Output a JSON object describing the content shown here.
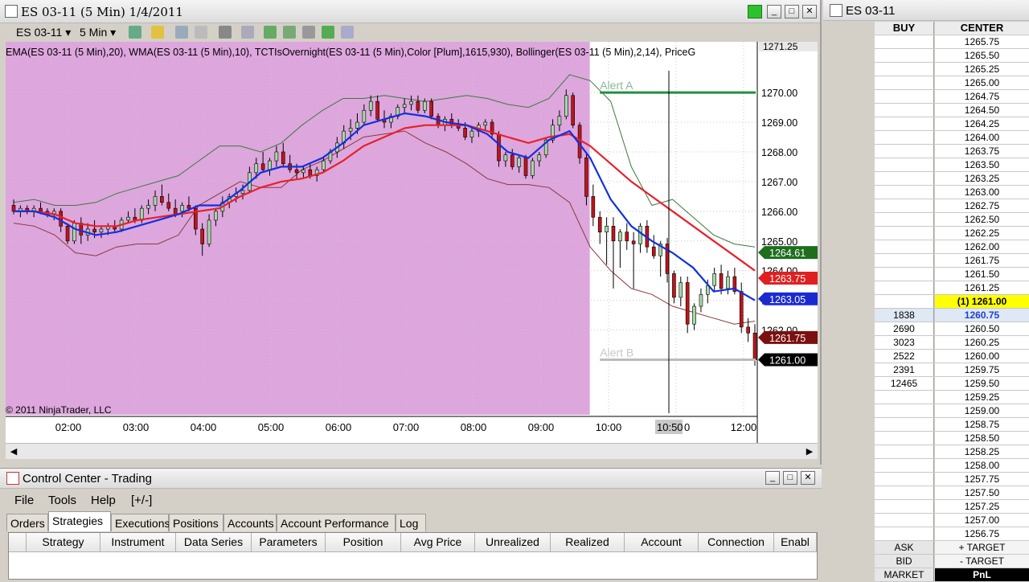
{
  "chart_window": {
    "title": "ES 03-11 (5 Min)  1/4/2011",
    "instrument_selector": "ES 03-11",
    "interval_selector": "5 Min",
    "indicator_label": "EMA(ES 03-11  (5 Min),20),  WMA(ES 03-11  (5 Min),10),  TCTIsOvernight(ES 03-11  (5 Min),Color  [Plum],1615,930),  Bollinger(ES 03-11  (5  Min),2,14),   PriceG",
    "copyright": "© 2011 NinjaTrader, LLC",
    "alert_a": "Alert A",
    "alert_b": "Alert B",
    "crosshair_time_label": "10:50",
    "crosshair_time_suffix": "0",
    "colors": {
      "overnight": "#dda6dd",
      "ema": "#e8202a",
      "wma": "#1030e0",
      "bollinger_overnight": "#5d7a5d",
      "bollinger_day": "#3a7a3a",
      "candle_up": "#a8d8a8",
      "candle_down": "#c0141a",
      "alert_a_line": "#209040",
      "alert_b_line": "#bbbbbb"
    },
    "price_markers": [
      {
        "label": "1264.61",
        "bg": "#1e6e1e",
        "value": 1264.61
      },
      {
        "label": "1263.75",
        "bg": "#e02020",
        "value": 1263.75
      },
      {
        "label": "1263.05",
        "bg": "#1a2ad0",
        "value": 1263.05
      },
      {
        "label": "1261.75",
        "bg": "#7a1010",
        "value": 1261.75
      },
      {
        "label": "1261.00",
        "bg": "#000000",
        "value": 1261.0
      }
    ],
    "top_price_label": "1271.25"
  },
  "chart_data": {
    "type": "candlestick",
    "y_ticks": [
      "1270.00",
      "1269.00",
      "1268.00",
      "1267.00",
      "1266.00",
      "1265.00",
      "1264.00",
      "1263.00",
      "1262.00"
    ],
    "x_ticks": [
      "02:00",
      "03:00",
      "04:00",
      "05:00",
      "06:00",
      "07:00",
      "08:00",
      "09:00",
      "10:00",
      "11:00",
      "12:00"
    ],
    "ylim": [
      1259.2,
      1271.6
    ],
    "alert_a_price": 1270.0,
    "alert_b_price": 1261.0,
    "bars": [
      [
        1266.2,
        1266.4,
        1265.9,
        1266.0
      ],
      [
        1266.0,
        1266.2,
        1265.8,
        1266.1
      ],
      [
        1266.1,
        1266.2,
        1265.9,
        1266.0
      ],
      [
        1266.0,
        1266.2,
        1265.8,
        1266.1
      ],
      [
        1266.1,
        1266.3,
        1265.9,
        1266.0
      ],
      [
        1266.0,
        1266.1,
        1265.8,
        1265.9
      ],
      [
        1265.9,
        1266.1,
        1265.7,
        1266.0
      ],
      [
        1266.0,
        1266.1,
        1265.3,
        1265.5
      ],
      [
        1265.5,
        1265.6,
        1264.9,
        1265.0
      ],
      [
        1265.0,
        1265.7,
        1264.9,
        1265.6
      ],
      [
        1265.6,
        1265.8,
        1264.9,
        1265.2
      ],
      [
        1265.2,
        1265.6,
        1265.0,
        1265.4
      ],
      [
        1265.4,
        1265.7,
        1265.1,
        1265.3
      ],
      [
        1265.3,
        1265.5,
        1265.1,
        1265.4
      ],
      [
        1265.4,
        1265.6,
        1265.2,
        1265.5
      ],
      [
        1265.5,
        1265.7,
        1265.3,
        1265.4
      ],
      [
        1265.4,
        1265.8,
        1265.3,
        1265.7
      ],
      [
        1265.7,
        1266.0,
        1265.6,
        1265.8
      ],
      [
        1265.8,
        1266.1,
        1265.6,
        1265.7
      ],
      [
        1265.7,
        1266.2,
        1265.6,
        1266.1
      ],
      [
        1266.1,
        1266.4,
        1265.9,
        1266.2
      ],
      [
        1266.2,
        1266.7,
        1266.0,
        1266.5
      ],
      [
        1266.5,
        1266.9,
        1266.2,
        1266.3
      ],
      [
        1266.3,
        1266.6,
        1266.0,
        1266.1
      ],
      [
        1266.1,
        1266.4,
        1265.8,
        1265.9
      ],
      [
        1266.0,
        1266.3,
        1265.8,
        1266.2
      ],
      [
        1266.2,
        1266.5,
        1266.0,
        1266.1
      ],
      [
        1266.1,
        1266.2,
        1265.2,
        1265.4
      ],
      [
        1265.4,
        1265.6,
        1264.5,
        1264.9
      ],
      [
        1264.9,
        1265.9,
        1264.8,
        1265.7
      ],
      [
        1265.7,
        1266.1,
        1265.5,
        1266.0
      ],
      [
        1266.0,
        1266.5,
        1265.8,
        1266.3
      ],
      [
        1266.3,
        1266.6,
        1266.1,
        1266.5
      ],
      [
        1266.5,
        1266.8,
        1266.3,
        1266.6
      ],
      [
        1266.6,
        1266.9,
        1266.4,
        1266.7
      ],
      [
        1266.7,
        1267.5,
        1266.6,
        1267.3
      ],
      [
        1267.3,
        1267.8,
        1267.1,
        1267.6
      ],
      [
        1267.6,
        1268.0,
        1267.3,
        1267.4
      ],
      [
        1267.4,
        1267.8,
        1267.2,
        1267.7
      ],
      [
        1267.7,
        1268.2,
        1267.5,
        1268.0
      ],
      [
        1268.0,
        1268.3,
        1267.5,
        1267.6
      ],
      [
        1267.6,
        1267.9,
        1267.3,
        1267.4
      ],
      [
        1267.4,
        1267.6,
        1267.1,
        1267.3
      ],
      [
        1267.3,
        1267.5,
        1267.1,
        1267.4
      ],
      [
        1267.4,
        1267.6,
        1267.1,
        1267.2
      ],
      [
        1267.2,
        1267.5,
        1267.0,
        1267.4
      ],
      [
        1267.4,
        1267.8,
        1267.3,
        1267.7
      ],
      [
        1267.7,
        1268.1,
        1267.6,
        1268.0
      ],
      [
        1268.0,
        1268.5,
        1267.8,
        1268.3
      ],
      [
        1268.3,
        1268.9,
        1268.1,
        1268.7
      ],
      [
        1268.7,
        1269.1,
        1268.4,
        1268.8
      ],
      [
        1268.8,
        1269.3,
        1268.6,
        1269.0
      ],
      [
        1269.0,
        1269.6,
        1268.9,
        1269.4
      ],
      [
        1269.4,
        1269.9,
        1269.2,
        1269.7
      ],
      [
        1269.7,
        1269.9,
        1269.0,
        1269.1
      ],
      [
        1269.1,
        1269.4,
        1268.8,
        1269.0
      ],
      [
        1269.0,
        1269.3,
        1268.8,
        1269.2
      ],
      [
        1269.2,
        1269.6,
        1269.1,
        1269.5
      ],
      [
        1269.5,
        1269.8,
        1269.3,
        1269.6
      ],
      [
        1269.6,
        1269.9,
        1269.4,
        1269.7
      ],
      [
        1269.7,
        1269.9,
        1269.3,
        1269.4
      ],
      [
        1269.4,
        1269.8,
        1269.3,
        1269.7
      ],
      [
        1269.7,
        1269.8,
        1269.1,
        1269.2
      ],
      [
        1269.2,
        1269.3,
        1268.8,
        1268.9
      ],
      [
        1268.9,
        1269.2,
        1268.7,
        1269.1
      ],
      [
        1269.1,
        1269.3,
        1268.8,
        1268.9
      ],
      [
        1268.9,
        1269.1,
        1268.7,
        1268.8
      ],
      [
        1268.8,
        1269.0,
        1268.4,
        1268.5
      ],
      [
        1268.5,
        1268.8,
        1268.3,
        1268.7
      ],
      [
        1268.7,
        1269.0,
        1268.5,
        1268.9
      ],
      [
        1268.9,
        1269.1,
        1268.7,
        1269.0
      ],
      [
        1269.0,
        1269.1,
        1268.5,
        1268.6
      ],
      [
        1268.6,
        1268.7,
        1267.5,
        1267.7
      ],
      [
        1267.7,
        1268.0,
        1267.5,
        1267.9
      ],
      [
        1267.9,
        1268.1,
        1267.4,
        1267.5
      ],
      [
        1267.5,
        1267.9,
        1267.3,
        1267.8
      ],
      [
        1267.8,
        1267.9,
        1267.1,
        1267.2
      ],
      [
        1267.2,
        1267.8,
        1267.1,
        1267.7
      ],
      [
        1267.7,
        1268.0,
        1267.5,
        1267.9
      ],
      [
        1267.9,
        1268.5,
        1267.8,
        1268.4
      ],
      [
        1268.4,
        1269.1,
        1268.3,
        1268.9
      ],
      [
        1268.9,
        1269.4,
        1268.7,
        1269.2
      ],
      [
        1269.2,
        1270.1,
        1269.1,
        1269.9
      ],
      [
        1269.9,
        1270.0,
        1268.8,
        1268.9
      ],
      [
        1268.9,
        1269.0,
        1267.6,
        1267.8
      ],
      [
        1267.8,
        1268.0,
        1266.2,
        1266.5
      ],
      [
        1266.5,
        1266.9,
        1265.5,
        1265.8
      ],
      [
        1265.8,
        1266.0,
        1264.9,
        1265.3
      ],
      [
        1265.3,
        1265.8,
        1264.2,
        1265.5
      ],
      [
        1265.5,
        1265.8,
        1263.4,
        1265.0
      ],
      [
        1265.0,
        1265.4,
        1264.1,
        1265.3
      ],
      [
        1265.3,
        1265.6,
        1264.7,
        1265.0
      ],
      [
        1265.0,
        1265.3,
        1263.4,
        1264.9
      ],
      [
        1264.9,
        1265.6,
        1264.6,
        1265.5
      ],
      [
        1265.5,
        1265.7,
        1264.6,
        1264.8
      ],
      [
        1264.8,
        1265.2,
        1264.4,
        1264.5
      ],
      [
        1264.5,
        1265.0,
        1263.8,
        1264.9
      ],
      [
        1264.9,
        1265.1,
        1263.6,
        1263.9
      ],
      [
        1263.9,
        1264.0,
        1262.9,
        1263.1
      ],
      [
        1263.1,
        1263.8,
        1262.8,
        1263.6
      ],
      [
        1263.6,
        1263.8,
        1261.9,
        1262.2
      ],
      [
        1262.2,
        1262.9,
        1262.0,
        1262.8
      ],
      [
        1262.8,
        1263.4,
        1262.6,
        1263.2
      ],
      [
        1263.2,
        1263.7,
        1262.9,
        1263.5
      ],
      [
        1263.5,
        1264.1,
        1263.3,
        1263.9
      ],
      [
        1263.9,
        1264.2,
        1263.2,
        1263.4
      ],
      [
        1263.4,
        1264.0,
        1263.2,
        1263.8
      ],
      [
        1263.8,
        1264.1,
        1263.2,
        1263.3
      ],
      [
        1263.3,
        1263.6,
        1261.9,
        1262.1
      ],
      [
        1262.1,
        1262.4,
        1261.6,
        1261.9
      ],
      [
        1261.9,
        1262.2,
        1260.8,
        1261.0
      ]
    ],
    "ema_path": [
      1266.0,
      1266.0,
      1265.9,
      1265.6,
      1265.5,
      1265.5,
      1265.7,
      1265.8,
      1265.9,
      1266.0,
      1266.1,
      1266.5,
      1266.8,
      1267.0,
      1267.1,
      1267.3,
      1267.7,
      1268.2,
      1268.5,
      1268.8,
      1268.9,
      1268.9,
      1268.9,
      1268.7,
      1268.5,
      1268.3,
      1268.5,
      1268.6,
      1268.2,
      1267.6,
      1267.0,
      1266.5,
      1266.0,
      1265.5,
      1265.0,
      1264.5,
      1264.0
    ],
    "wma_path": [
      1266.0,
      1266.0,
      1265.8,
      1265.4,
      1265.2,
      1265.3,
      1265.5,
      1265.7,
      1265.9,
      1266.2,
      1266.2,
      1266.7,
      1267.3,
      1267.5,
      1267.5,
      1267.8,
      1268.3,
      1268.9,
      1269.1,
      1269.3,
      1269.2,
      1269.0,
      1268.9,
      1268.6,
      1268.0,
      1267.8,
      1268.4,
      1268.7,
      1267.8,
      1266.4,
      1265.5,
      1265.0,
      1264.6,
      1264.1,
      1263.3,
      1263.4,
      1263.0
    ],
    "bb_upper_path": [
      1266.3,
      1266.4,
      1266.2,
      1266.2,
      1266.3,
      1266.6,
      1266.8,
      1267.0,
      1267.2,
      1267.7,
      1268.2,
      1268.2,
      1268.0,
      1268.3,
      1268.9,
      1269.4,
      1269.8,
      1269.8,
      1269.9,
      1269.8,
      1269.7,
      1269.8,
      1269.9,
      1269.8,
      1269.6,
      1269.5,
      1269.8,
      1270.6,
      1270.4,
      1269.7,
      1267.5,
      1266.2,
      1266.4,
      1265.8,
      1265.2,
      1264.9,
      1264.8
    ],
    "bb_lower_path": [
      1265.6,
      1265.5,
      1265.2,
      1264.6,
      1264.5,
      1264.8,
      1264.9,
      1264.9,
      1265.2,
      1266.2,
      1266.6,
      1267.0,
      1266.8,
      1266.8,
      1267.4,
      1267.7,
      1268.1,
      1268.5,
      1268.6,
      1268.7,
      1268.3,
      1268.0,
      1267.6,
      1267.1,
      1266.9,
      1266.9,
      1266.8,
      1266.3,
      1264.8,
      1264.0,
      1263.4,
      1263.2,
      1262.8,
      1262.6,
      1262.4,
      1262.2,
      1262.3
    ]
  },
  "control_center": {
    "title": "Control Center - Trading",
    "menu": [
      "File",
      "Tools",
      "Help",
      "[+/-]"
    ],
    "tabs": [
      "Orders",
      "Strategies",
      "Executions",
      "Positions",
      "Accounts",
      "Account Performance",
      "Log"
    ],
    "active_tab": "Strategies",
    "columns": [
      "Strategy",
      "Instrument",
      "Data Series",
      "Parameters",
      "Position",
      "Avg Price",
      "Unrealized",
      "Realized",
      "Account",
      "Connection",
      "Enabl"
    ]
  },
  "superdom": {
    "title": "ES 03-11",
    "header": {
      "buy": "BUY",
      "center": "CENTER"
    },
    "rows": [
      {
        "buy": "",
        "center": "1265.75"
      },
      {
        "buy": "",
        "center": "1265.50"
      },
      {
        "buy": "",
        "center": "1265.25"
      },
      {
        "buy": "",
        "center": "1265.00"
      },
      {
        "buy": "",
        "center": "1264.75"
      },
      {
        "buy": "",
        "center": "1264.50"
      },
      {
        "buy": "",
        "center": "1264.25"
      },
      {
        "buy": "",
        "center": "1264.00"
      },
      {
        "buy": "",
        "center": "1263.75"
      },
      {
        "buy": "",
        "center": "1263.50"
      },
      {
        "buy": "",
        "center": "1263.25"
      },
      {
        "buy": "",
        "center": "1263.00"
      },
      {
        "buy": "",
        "center": "1262.75"
      },
      {
        "buy": "",
        "center": "1262.50"
      },
      {
        "buy": "",
        "center": "1262.25"
      },
      {
        "buy": "",
        "center": "1262.00"
      },
      {
        "buy": "",
        "center": "1261.75"
      },
      {
        "buy": "",
        "center": "1261.50"
      },
      {
        "buy": "",
        "center": "1261.25"
      },
      {
        "buy": "",
        "center": "(1) 1261.00",
        "cls": "last"
      },
      {
        "buy": "1838",
        "center": "1260.75",
        "cls": "cur"
      },
      {
        "buy": "2690",
        "center": "1260.50"
      },
      {
        "buy": "3023",
        "center": "1260.25"
      },
      {
        "buy": "2522",
        "center": "1260.00"
      },
      {
        "buy": "2391",
        "center": "1259.75"
      },
      {
        "buy": "12465",
        "center": "1259.50"
      },
      {
        "buy": "",
        "center": "1259.25"
      },
      {
        "buy": "",
        "center": "1259.00"
      },
      {
        "buy": "",
        "center": "1258.75"
      },
      {
        "buy": "",
        "center": "1258.50"
      },
      {
        "buy": "",
        "center": "1258.25"
      },
      {
        "buy": "",
        "center": "1258.00"
      },
      {
        "buy": "",
        "center": "1257.75"
      },
      {
        "buy": "",
        "center": "1257.50"
      },
      {
        "buy": "",
        "center": "1257.25"
      },
      {
        "buy": "",
        "center": "1257.00"
      },
      {
        "buy": "",
        "center": "1256.75"
      }
    ],
    "footer": [
      {
        "buy": "ASK",
        "center": "+ TARGET"
      },
      {
        "buy": "BID",
        "center": "- TARGET"
      },
      {
        "buy": "MARKET",
        "center": "PnL",
        "cls": "black"
      }
    ]
  }
}
